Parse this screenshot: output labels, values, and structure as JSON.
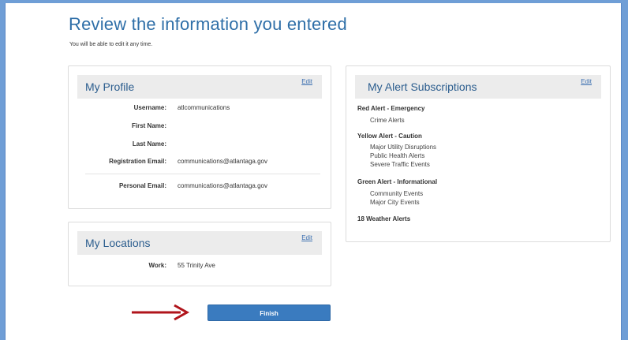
{
  "header": {
    "title": "Review the information you entered",
    "subtitle": "You will be able to edit it any time."
  },
  "profile": {
    "title": "My Profile",
    "edit_label": "Edit",
    "fields": [
      {
        "label": "Username:",
        "value": "atlcommunications"
      },
      {
        "label": "First Name:",
        "value": ""
      },
      {
        "label": "Last Name:",
        "value": ""
      },
      {
        "label": "Registration Email:",
        "value": "communications@atlantaga.gov"
      },
      {
        "label": "Personal Email:",
        "value": "communications@atlantaga.gov"
      }
    ]
  },
  "locations": {
    "title": "My Locations",
    "edit_label": "Edit",
    "fields": [
      {
        "label": "Work:",
        "value": "55 Trinity Ave"
      }
    ]
  },
  "alerts": {
    "title": "My Alert Subscriptions",
    "edit_label": "Edit",
    "groups": [
      {
        "name": "Red Alert - Emergency",
        "items": [
          "Crime Alerts"
        ]
      },
      {
        "name": "Yellow Alert - Caution",
        "items": [
          "Major Utility Disruptions",
          "Public Health Alerts",
          "Severe Traffic Events"
        ]
      },
      {
        "name": "Green Alert - Informational",
        "items": [
          "Community Events",
          "Major City Events"
        ]
      }
    ],
    "weather": "18 Weather Alerts"
  },
  "actions": {
    "finish_label": "Finish"
  },
  "colors": {
    "accent": "#3a7bbf",
    "title": "#2f6fa8",
    "arrow": "#b0141b",
    "frame": "#6f9ed6"
  }
}
